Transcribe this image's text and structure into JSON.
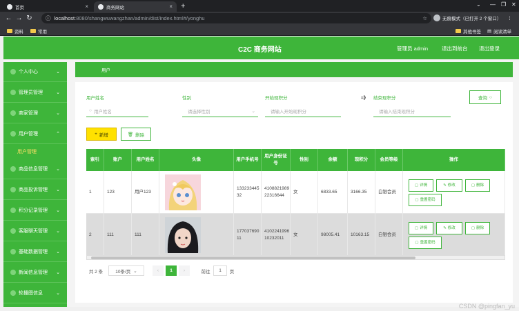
{
  "browser": {
    "tabs": [
      {
        "label": "首页"
      },
      {
        "label": "商务网站"
      }
    ],
    "url_host": "localhost",
    "url_path": ":8080/shangwuwangzhan/admin/dist/index.html#/yonghu",
    "incognito_label": "无痕模式（已打开 2 个窗口）",
    "bookmarks": [
      "资料",
      "常用"
    ],
    "bookmarks_right": [
      "其他书签",
      "阅读清单"
    ]
  },
  "header": {
    "site_title": "C2C 商务网站",
    "admin_label": "管理员 admin",
    "back_to_front": "退出到前台",
    "logout": "退出登录"
  },
  "sidebar": {
    "items": [
      {
        "label": "个人中心"
      },
      {
        "label": "管理员管理"
      },
      {
        "label": "商家管理"
      },
      {
        "label": "用户管理"
      },
      {
        "label": "商品信息管理"
      },
      {
        "label": "商品投诉管理"
      },
      {
        "label": "积分记录管理"
      },
      {
        "label": "客服聊天管理"
      },
      {
        "label": "基础数据管理"
      },
      {
        "label": "新闻信息管理"
      },
      {
        "label": "轮播图信息"
      }
    ],
    "active_sub": "用户管理"
  },
  "breadcrumb": {
    "text": "用户"
  },
  "filters": {
    "name_label": "用户姓名",
    "name_placeholder": "用户姓名",
    "gender_label": "性别",
    "gender_placeholder": "请选择性别",
    "start_label": "开始现积分",
    "start_placeholder": "请输入开始现积分",
    "range_sep": "=》",
    "end_label": "结束现积分",
    "end_placeholder": "请输入结束现积分",
    "query_button": "查询"
  },
  "actions": {
    "add": "新增",
    "delete": "删除"
  },
  "table": {
    "headers": [
      "索引",
      "账户",
      "用户姓名",
      "头像",
      "用户手机号",
      "用户身份证号",
      "性别",
      "余额",
      "现积分",
      "会员等级",
      "操作"
    ],
    "rows": [
      {
        "index": "1",
        "account": "123",
        "name": "用户123",
        "phone": "13323344532",
        "idcard": "410882198922316644",
        "gender": "女",
        "balance": "6833.65",
        "points": "3166.35",
        "level": "白银会员"
      },
      {
        "index": "2",
        "account": "111",
        "name": "111",
        "phone": "17703769011",
        "idcard": "410224199610232011",
        "gender": "女",
        "balance": "98005.41",
        "points": "10163.15",
        "level": "白银会员"
      }
    ],
    "row_actions": {
      "detail": "详情",
      "edit": "修改",
      "delete": "删除",
      "reset": "重置密码"
    }
  },
  "pagination": {
    "total": "共 2 条",
    "page_size": "10条/页",
    "current": "1",
    "goto_label": "前往",
    "goto_value": "1",
    "page_unit": "页"
  },
  "watermark": "CSDN @pingfan_yu",
  "colors": {
    "primary": "#3eb53a",
    "add_button": "#ffe100"
  }
}
